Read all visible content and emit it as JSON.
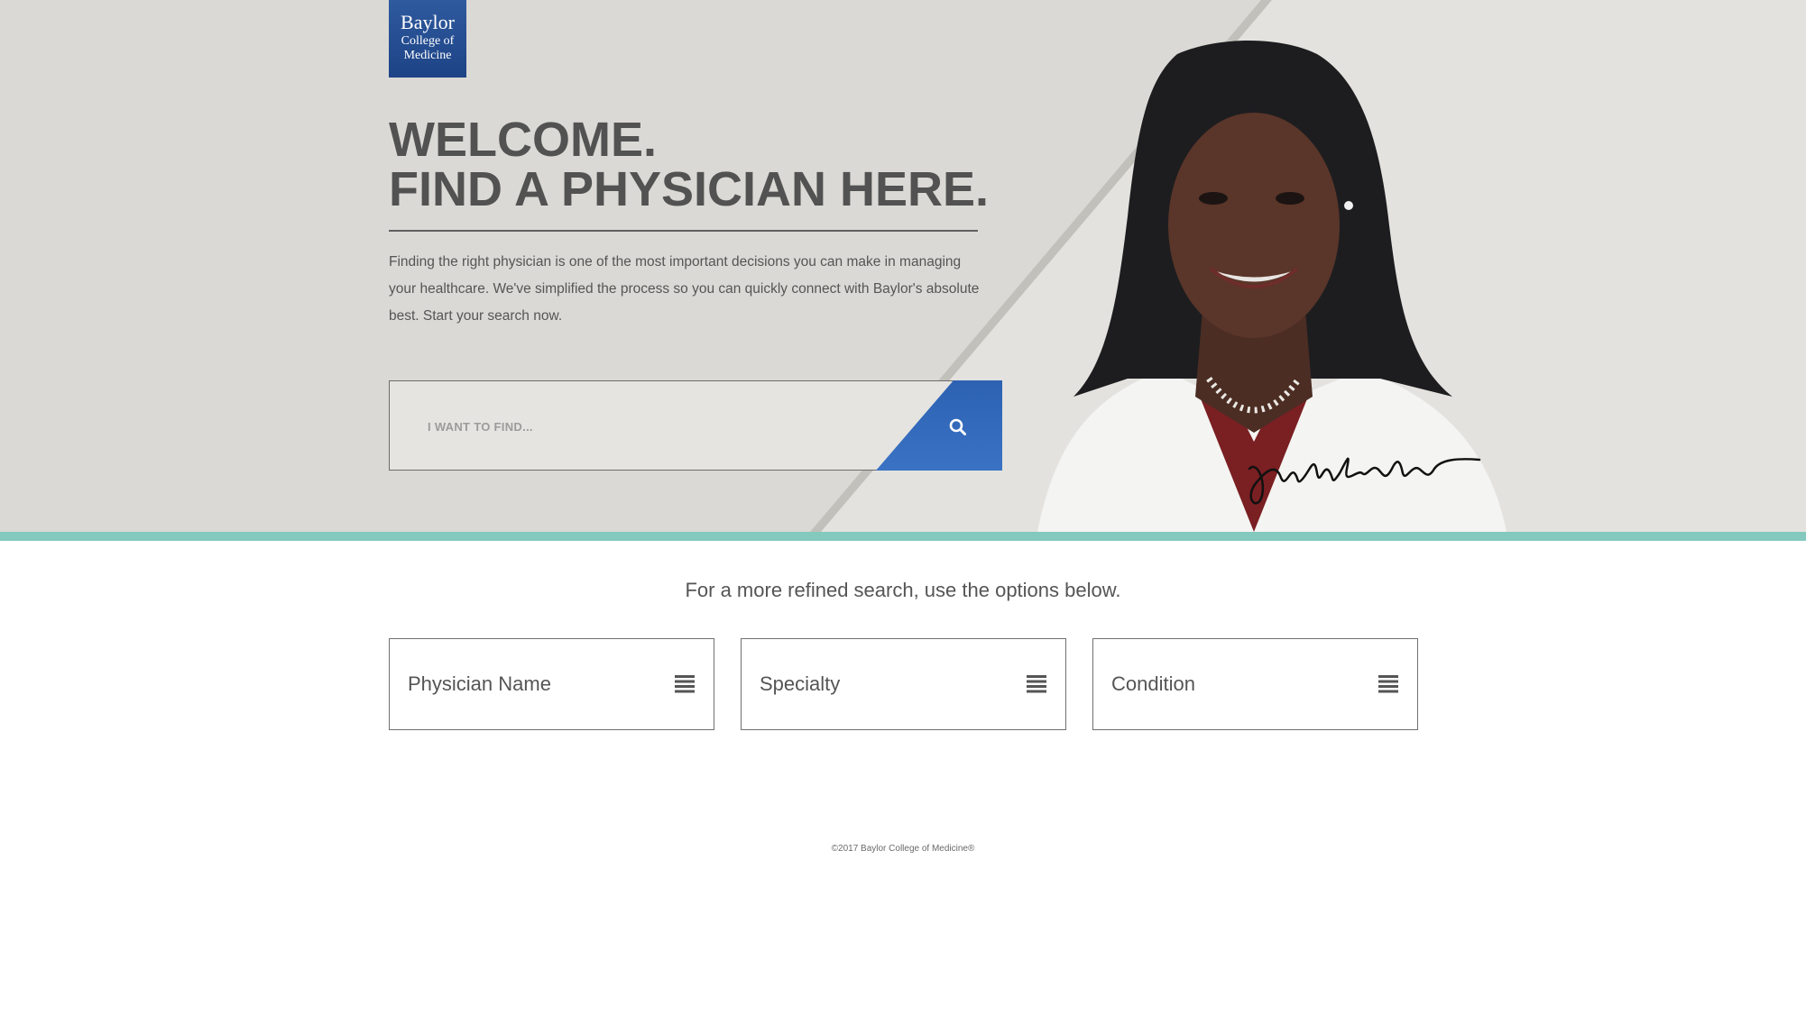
{
  "logo": {
    "line1": "Baylor",
    "line2": "College of",
    "line3": "Medicine"
  },
  "hero": {
    "headline_line1": "WELCOME.",
    "headline_line2": "FIND A PHYSICIAN HERE.",
    "intro": "Finding the right physician is one of the most important decisions you can make in managing your healthcare. We've simplified the process so you can quickly connect with Baylor's absolute best. Start your search now.",
    "search_placeholder": "I WANT TO FIND..."
  },
  "refine": {
    "prompt": "For a more refined search, use the options below.",
    "options": [
      {
        "label": "Physician Name",
        "icon": "list-icon"
      },
      {
        "label": "Specialty",
        "icon": "list-icon"
      },
      {
        "label": "Condition",
        "icon": "list-icon"
      }
    ]
  },
  "footer": {
    "copyright": "©2017 Baylor College of Medicine®"
  },
  "colors": {
    "hero_bg": "#dad9d5",
    "accent_bar": "#84c9bd",
    "brand_blue": "#2f65b5",
    "text": "#555555"
  }
}
